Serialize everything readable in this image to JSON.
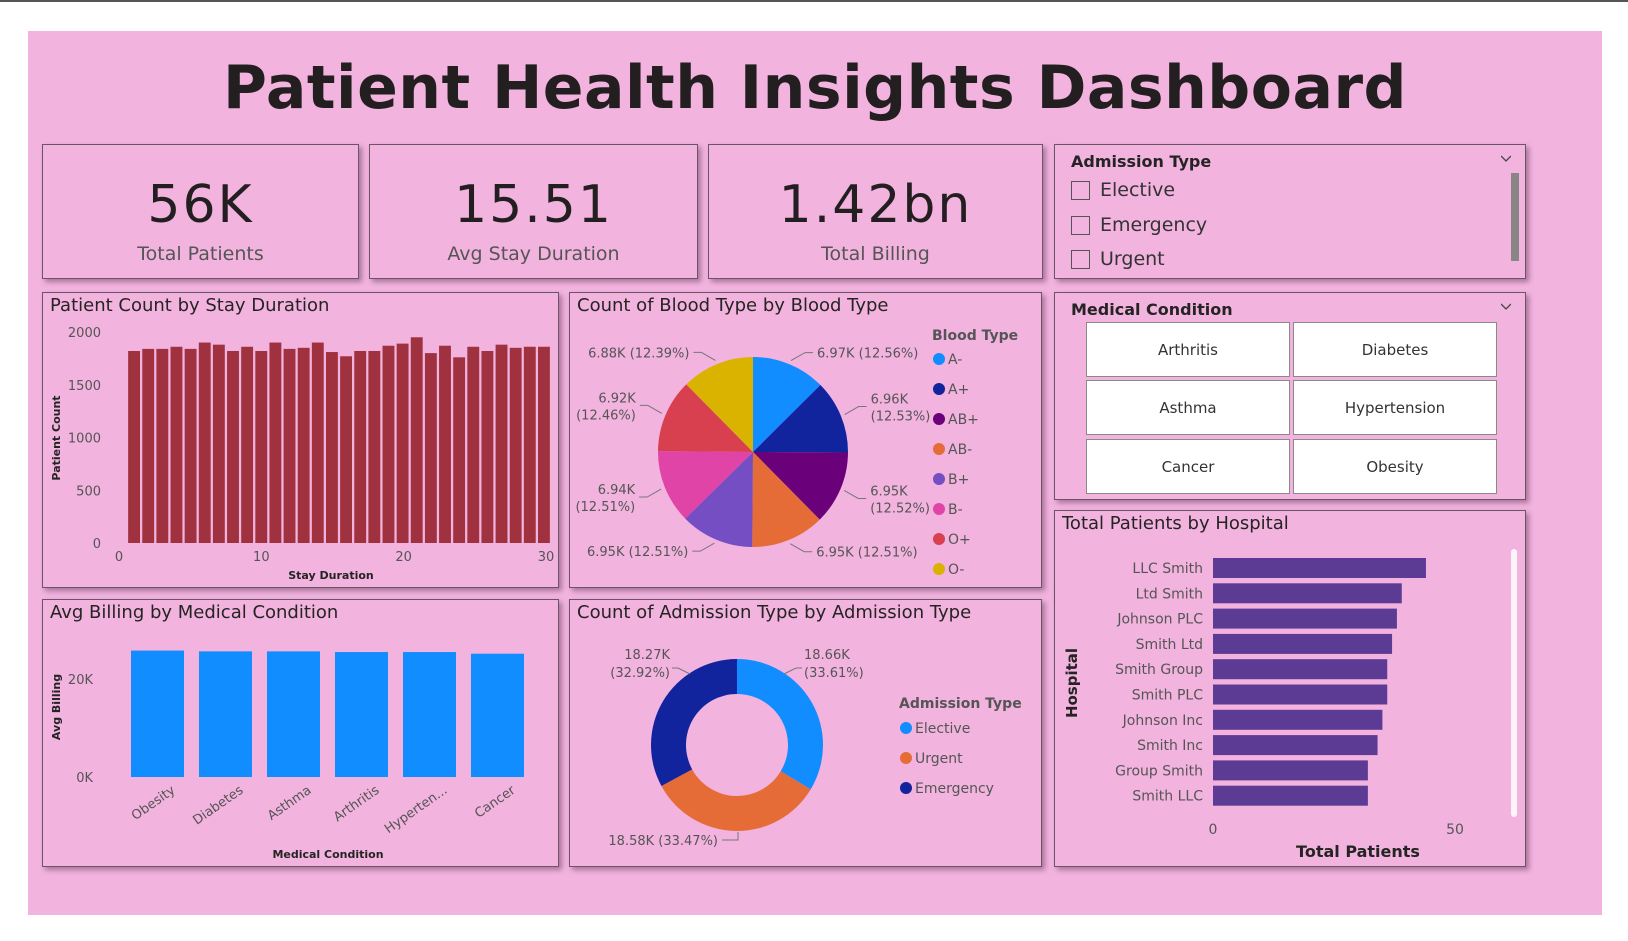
{
  "dashboard": {
    "title": "Patient Health Insights Dashboard"
  },
  "kpis": [
    {
      "value": "56K",
      "label": "Total Patients"
    },
    {
      "value": "15.51",
      "label": "Avg Stay Duration"
    },
    {
      "value": "1.42bn",
      "label": "Total Billing"
    }
  ],
  "admission_slicer": {
    "title": "Admission Type",
    "options": [
      "Elective",
      "Emergency",
      "Urgent"
    ]
  },
  "condition_slicer": {
    "title": "Medical Condition",
    "tiles": [
      "Arthritis",
      "Diabetes",
      "Asthma",
      "Hypertension",
      "Cancer",
      "Obesity"
    ]
  },
  "colors": {
    "background": "#f2b3df",
    "stay_bar": "#a0313f",
    "billing_bar": "#118dff",
    "hospital_bar": "#5c3b95"
  },
  "chart_data": [
    {
      "type": "bar",
      "title": "Patient Count by Stay Duration",
      "xlabel": "Stay Duration",
      "ylabel": "Patient Count",
      "x": [
        1,
        2,
        3,
        4,
        5,
        6,
        7,
        8,
        9,
        10,
        11,
        12,
        13,
        14,
        15,
        16,
        17,
        18,
        19,
        20,
        21,
        22,
        23,
        24,
        25,
        26,
        27,
        28,
        29,
        30
      ],
      "values": [
        1820,
        1840,
        1840,
        1860,
        1840,
        1900,
        1880,
        1820,
        1860,
        1820,
        1900,
        1840,
        1850,
        1900,
        1810,
        1770,
        1820,
        1820,
        1870,
        1890,
        1950,
        1800,
        1870,
        1760,
        1860,
        1820,
        1880,
        1850,
        1860,
        1860
      ],
      "ylim": [
        0,
        2000
      ],
      "yticks": [
        "0",
        "500",
        "1000",
        "1500",
        "2000"
      ],
      "xticks": [
        "0",
        "10",
        "20",
        "30"
      ],
      "xlim": [
        0,
        30
      ]
    },
    {
      "type": "pie",
      "title": "Count of Blood Type by Blood Type",
      "legend_title": "Blood Type",
      "categories": [
        "A-",
        "A+",
        "AB+",
        "AB-",
        "B+",
        "B-",
        "O+",
        "O-"
      ],
      "values": [
        6970,
        6960,
        6950,
        6950,
        6950,
        6940,
        6920,
        6880
      ],
      "labels": [
        "6.97K (12.56%)",
        "6.96K (12.53%)",
        "6.95K (12.52%)",
        "6.95K (12.51%)",
        "6.95K (12.51%)",
        "6.94K (12.51%)",
        "6.92K (12.46%)",
        "6.88K (12.39%)"
      ],
      "colors": [
        "#118dff",
        "#12239e",
        "#6b007b",
        "#e66c37",
        "#744ec2",
        "#e044a7",
        "#d9404f",
        "#d9b300"
      ]
    },
    {
      "type": "bar",
      "title": "Avg Billing by Medical Condition",
      "xlabel": "Medical Condition",
      "ylabel": "Avg Billing",
      "categories": [
        "Obesity",
        "Diabetes",
        "Asthma",
        "Arthritis",
        "Hyperten...",
        "Cancer"
      ],
      "values": [
        25800,
        25640,
        25640,
        25500,
        25500,
        25160
      ],
      "ylim": [
        0,
        30000
      ],
      "yticks": [
        "0K",
        "20K"
      ]
    },
    {
      "type": "pie",
      "title": "Count of Admission Type by Admission Type",
      "legend_title": "Admission Type",
      "categories": [
        "Elective",
        "Urgent",
        "Emergency"
      ],
      "values": [
        18660,
        18580,
        18270
      ],
      "labels": [
        "18.66K (33.61%)",
        "18.58K (33.47%)",
        "18.27K (32.92%)"
      ],
      "colors": [
        "#118dff",
        "#e66c37",
        "#12239e"
      ]
    },
    {
      "type": "bar",
      "title": "Total Patients by Hospital",
      "xlabel": "Total Patients",
      "ylabel": "Hospital",
      "categories": [
        "LLC Smith",
        "Ltd Smith",
        "Johnson PLC",
        "Smith Ltd",
        "Smith Group",
        "Smith PLC",
        "Johnson Inc",
        "Smith Inc",
        "Group Smith",
        "Smith LLC"
      ],
      "values": [
        44,
        39,
        38,
        37,
        36,
        36,
        35,
        34,
        32,
        32
      ],
      "xlim": [
        0,
        55
      ],
      "xticks": [
        "0",
        "50"
      ]
    }
  ]
}
